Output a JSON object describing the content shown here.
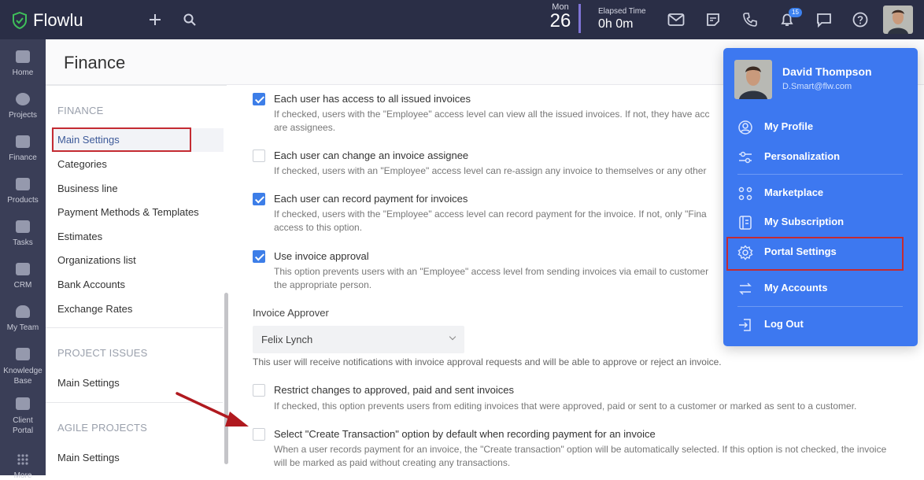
{
  "topbar": {
    "logo_text": "Flowlu",
    "date_month": "Mon",
    "date_day": "26",
    "elapsed_label": "Elapsed Time",
    "elapsed_value": "0h 0m",
    "notification_count": "15",
    "icons": [
      "plus-icon",
      "search-icon",
      "mail-icon",
      "notes-icon",
      "phone-icon",
      "bell-icon",
      "chat-icon",
      "help-icon"
    ]
  },
  "leftnav": {
    "items": [
      {
        "label": "Home",
        "icon": "home-icon"
      },
      {
        "label": "Projects",
        "icon": "projects-icon"
      },
      {
        "label": "Finance",
        "icon": "finance-icon"
      },
      {
        "label": "Products",
        "icon": "products-icon"
      },
      {
        "label": "Tasks",
        "icon": "tasks-icon"
      },
      {
        "label": "CRM",
        "icon": "crm-icon"
      },
      {
        "label": "My Team",
        "icon": "team-icon"
      },
      {
        "label": "Knowledge Base",
        "icon": "knowledge-icon"
      },
      {
        "label": "Client Portal",
        "icon": "portal-icon"
      },
      {
        "label": "More",
        "icon": "more-icon"
      }
    ]
  },
  "page": {
    "title": "Finance"
  },
  "sidemenu": {
    "finance_title": "FINANCE",
    "finance_items": [
      "Main Settings",
      "Categories",
      "Business line",
      "Payment Methods & Templates",
      "Estimates",
      "Organizations list",
      "Bank Accounts",
      "Exchange Rates"
    ],
    "project_issues_title": "PROJECT ISSUES",
    "project_issues_items": [
      "Main Settings"
    ],
    "agile_title": "AGILE PROJECTS",
    "agile_items": [
      "Main Settings"
    ]
  },
  "options": [
    {
      "checked": true,
      "title": "Each user has access to all issued invoices",
      "desc": "If checked, users with the \"Employee\" access level can view all the issued invoices. If not, they have acc are assignees."
    },
    {
      "checked": false,
      "title": "Each user can change an invoice assignee",
      "desc": "If checked, users with an \"Employee\" access level can re-assign any invoice to themselves or any other"
    },
    {
      "checked": true,
      "title": "Each user can record payment for invoices",
      "desc": "If checked, users with the \"Employee\" access level can record payment for the invoice. If not, only \"Fina access to this option."
    },
    {
      "checked": true,
      "title": "Use invoice approval",
      "desc": "This option prevents users with an \"Employee\" access level from sending invoices via email to customer the appropriate person."
    },
    {
      "checked": false,
      "title": "Restrict changes to approved, paid and sent invoices",
      "desc": "If checked, this option prevents users from editing invoices that were approved, paid or sent to a customer or marked as sent to a customer."
    },
    {
      "checked": false,
      "title": "Select \"Create Transaction\" option by default when recording payment for an invoice",
      "desc": "When a user records payment for an invoice, the \"Create transaction\" option will be automatically selected. If this option is not checked, the invoice will be marked as paid without creating any transactions."
    }
  ],
  "approver": {
    "label": "Invoice Approver",
    "value": "Felix Lynch",
    "hint": "This user will receive notifications with invoice approval requests and will be able to approve or reject an invoice."
  },
  "dropdown": {
    "name": "David Thompson",
    "email": "D.Smart@flw.com",
    "items": [
      {
        "label": "My Profile",
        "icon": "profile-icon"
      },
      {
        "label": "Personalization",
        "icon": "sliders-icon"
      },
      {
        "label": "Marketplace",
        "icon": "apps-icon"
      },
      {
        "label": "My Subscription",
        "icon": "subscription-icon"
      },
      {
        "label": "Portal Settings",
        "icon": "gear-icon"
      },
      {
        "label": "My Accounts",
        "icon": "swap-icon"
      },
      {
        "label": "Log Out",
        "icon": "logout-icon"
      }
    ]
  },
  "colors": {
    "topbar": "#2a2e46",
    "nav": "#3a3e57",
    "accent": "#3d78f0",
    "highlight": "#c42b32",
    "arrow": "#b0191f"
  }
}
